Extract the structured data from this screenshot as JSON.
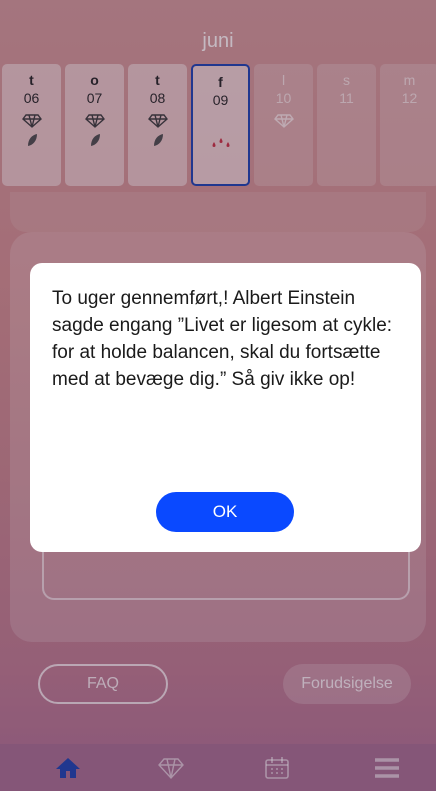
{
  "calendar": {
    "month": "juni",
    "days": [
      {
        "name": "t",
        "date": "06"
      },
      {
        "name": "o",
        "date": "07"
      },
      {
        "name": "t",
        "date": "08"
      },
      {
        "name": "f",
        "date": "09"
      },
      {
        "name": "l",
        "date": "10"
      },
      {
        "name": "s",
        "date": "11"
      },
      {
        "name": "m",
        "date": "12"
      }
    ]
  },
  "buttons": {
    "faq": "FAQ",
    "forecast": "Forudsigelse"
  },
  "dialog": {
    "message": "To uger gennemført,! Albert Einstein sagde engang ”Livet er ligesom at cykle: for at holde balancen, skal du fortsætte med at bevæge dig.” Så giv ikke op!",
    "ok_label": "OK"
  },
  "colors": {
    "accent": "#0a49ff",
    "selected_day_border": "#1239a8",
    "active_tab": "#1239a8",
    "drop": "#c0283a"
  },
  "icons": {
    "tabs": [
      "home-icon",
      "diamond-icon",
      "calendar-icon",
      "menu-icon"
    ]
  }
}
